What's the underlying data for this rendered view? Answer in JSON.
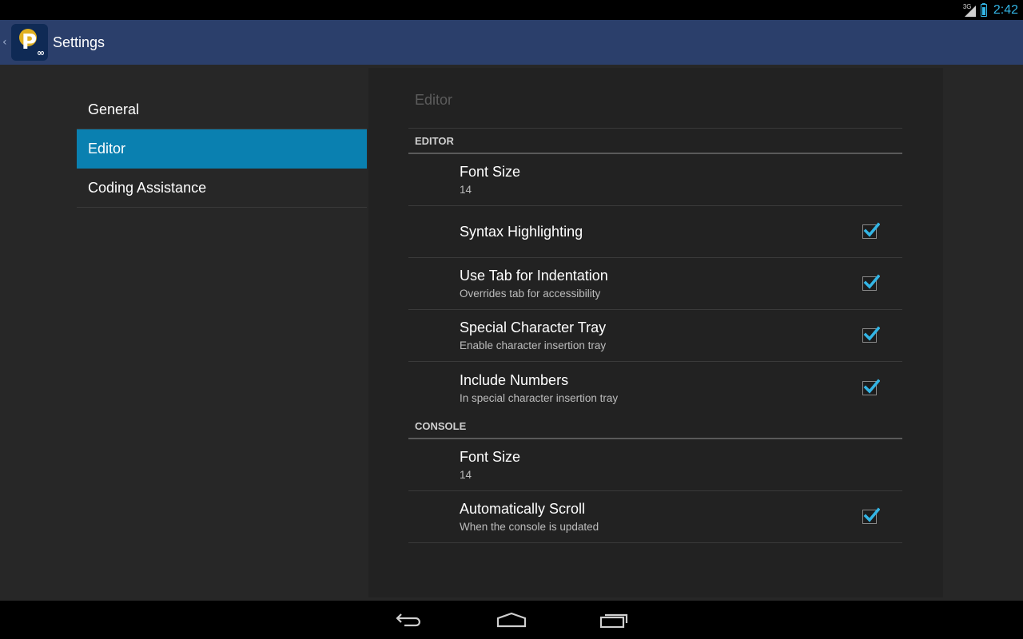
{
  "status_bar": {
    "network": "3G",
    "time": "2:42",
    "accent": "#33b5e5"
  },
  "action_bar": {
    "title": "Settings",
    "up_caret": "‹",
    "icon_letter": "P",
    "icon_infinity": "∞",
    "background": "#2b3f6b"
  },
  "headers": [
    {
      "label": "General",
      "selected": false
    },
    {
      "label": "Editor",
      "selected": true
    },
    {
      "label": "Coding Assistance",
      "selected": false
    }
  ],
  "pane": {
    "breadcrumb": "Editor",
    "categories": [
      {
        "title": "EDITOR",
        "prefs": [
          {
            "title": "Font Size",
            "summary": "14",
            "checkbox": false
          },
          {
            "title": "Syntax Highlighting",
            "summary": "",
            "checkbox": true,
            "checked": true
          },
          {
            "title": "Use Tab for Indentation",
            "summary": "Overrides tab for accessibility",
            "checkbox": true,
            "checked": true
          },
          {
            "title": "Special Character Tray",
            "summary": "Enable character insertion tray",
            "checkbox": true,
            "checked": true
          },
          {
            "title": "Include Numbers",
            "summary": "In special character insertion tray",
            "checkbox": true,
            "checked": true
          }
        ]
      },
      {
        "title": "CONSOLE",
        "prefs": [
          {
            "title": "Font Size",
            "summary": "14",
            "checkbox": false
          },
          {
            "title": "Automatically Scroll",
            "summary": "When the console is updated",
            "checkbox": true,
            "checked": true
          }
        ]
      }
    ]
  },
  "nav_bar": {
    "buttons": [
      "back-icon",
      "home-icon",
      "recents-icon"
    ]
  },
  "colors": {
    "selected_header": "#0a80b0",
    "check": "#33b5e5"
  }
}
